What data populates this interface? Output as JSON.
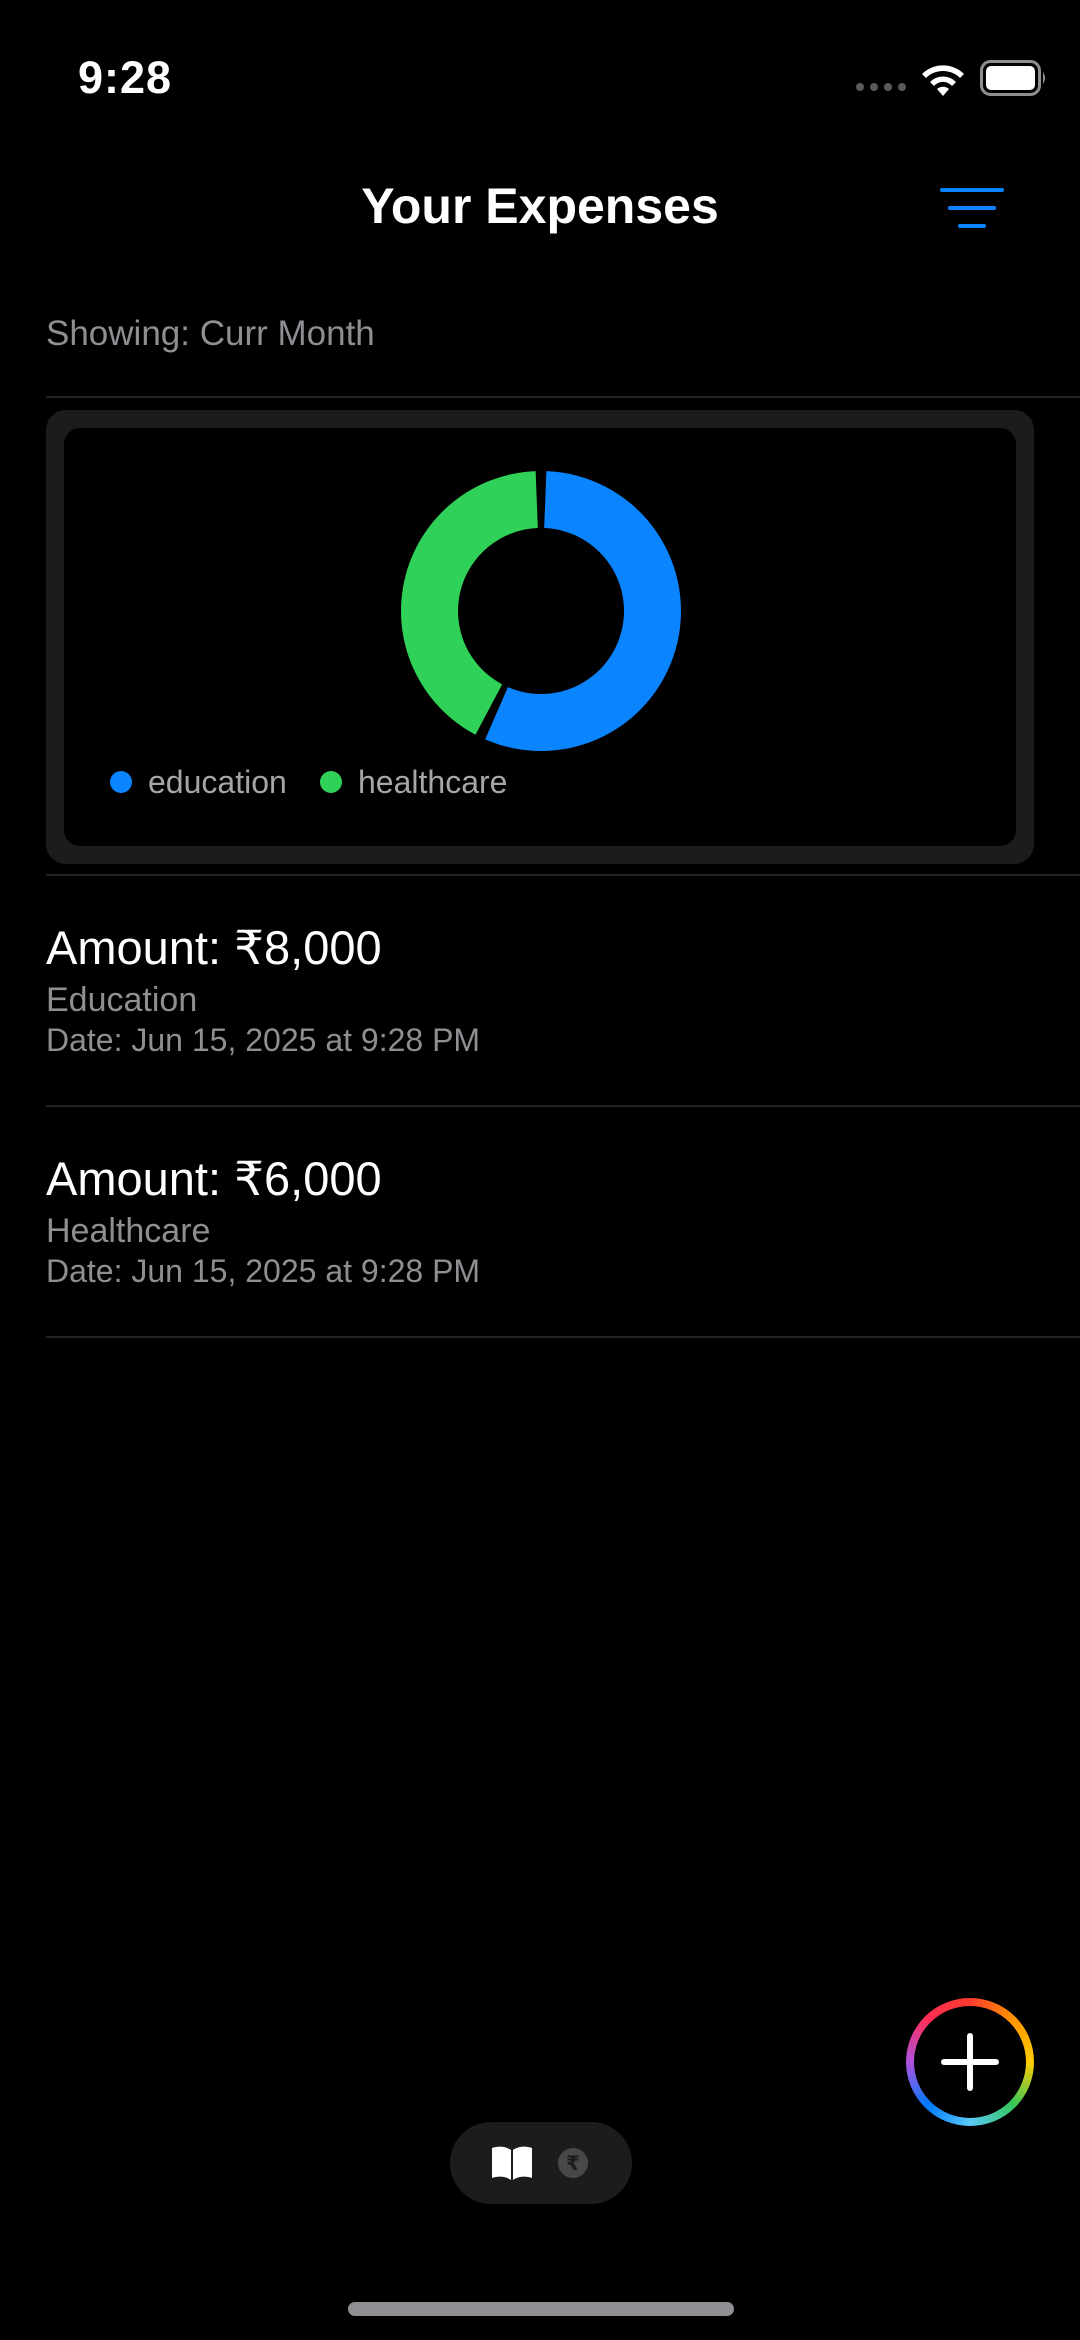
{
  "status_bar": {
    "time": "9:28"
  },
  "nav": {
    "title": "Your Expenses",
    "filter_icon": "filter-lines-icon"
  },
  "filter": {
    "showing_text": "Showing: Curr Month"
  },
  "chart_data": {
    "type": "pie",
    "style": "donut",
    "categories": [
      "education",
      "healthcare"
    ],
    "values": [
      8000,
      6000
    ],
    "colors": [
      "#0a84ff",
      "#30d158"
    ],
    "legend_placement": "bottom-left"
  },
  "expenses": [
    {
      "amount": "Amount: ₹8,000",
      "category": "Education",
      "date": "Date: Jun 15, 2025 at 9:28 PM"
    },
    {
      "amount": "Amount: ₹6,000",
      "category": "Healthcare",
      "date": "Date: Jun 15, 2025 at 9:28 PM"
    }
  ],
  "fab": {
    "icon": "plus-icon"
  },
  "tabs": {
    "book_icon": "book-icon",
    "rupee_icon": "rupee-icon",
    "rupee_symbol": "₹"
  },
  "colors": {
    "accent": "#0a84ff",
    "secondary_text": "#8e8e93",
    "card_background": "#1c1c1e"
  }
}
